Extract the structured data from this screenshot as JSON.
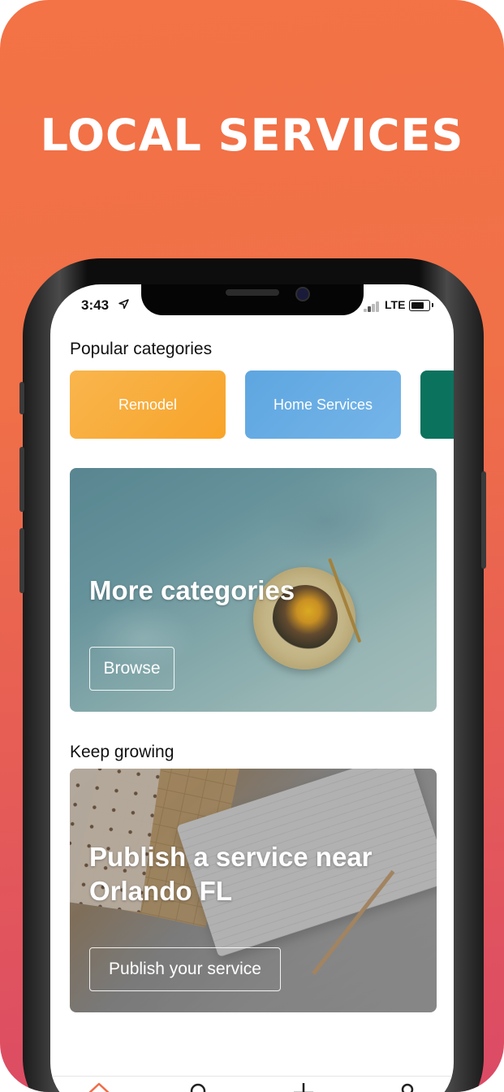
{
  "promo": {
    "headline": "LOCAL SERVICES"
  },
  "status_bar": {
    "time": "3:43",
    "network": "LTE"
  },
  "popular": {
    "title": "Popular categories",
    "categories": [
      {
        "label": "Remodel",
        "color": "#f8a42a"
      },
      {
        "label": "Home Services",
        "color": "#6aafe6"
      },
      {
        "label": "",
        "color": "#0b725e"
      }
    ]
  },
  "more_card": {
    "heading": "More categories",
    "button": "Browse"
  },
  "grow": {
    "title": "Keep growing",
    "heading": "Publish a service near Orlando FL",
    "button": "Publish your service"
  },
  "tab_bar": {
    "icons": [
      "home-icon",
      "search-icon",
      "add-icon",
      "profile-icon"
    ],
    "active_color": "#f06c48"
  },
  "colors": {
    "gradient_top": "#f37246",
    "gradient_bottom": "#db4a66"
  }
}
